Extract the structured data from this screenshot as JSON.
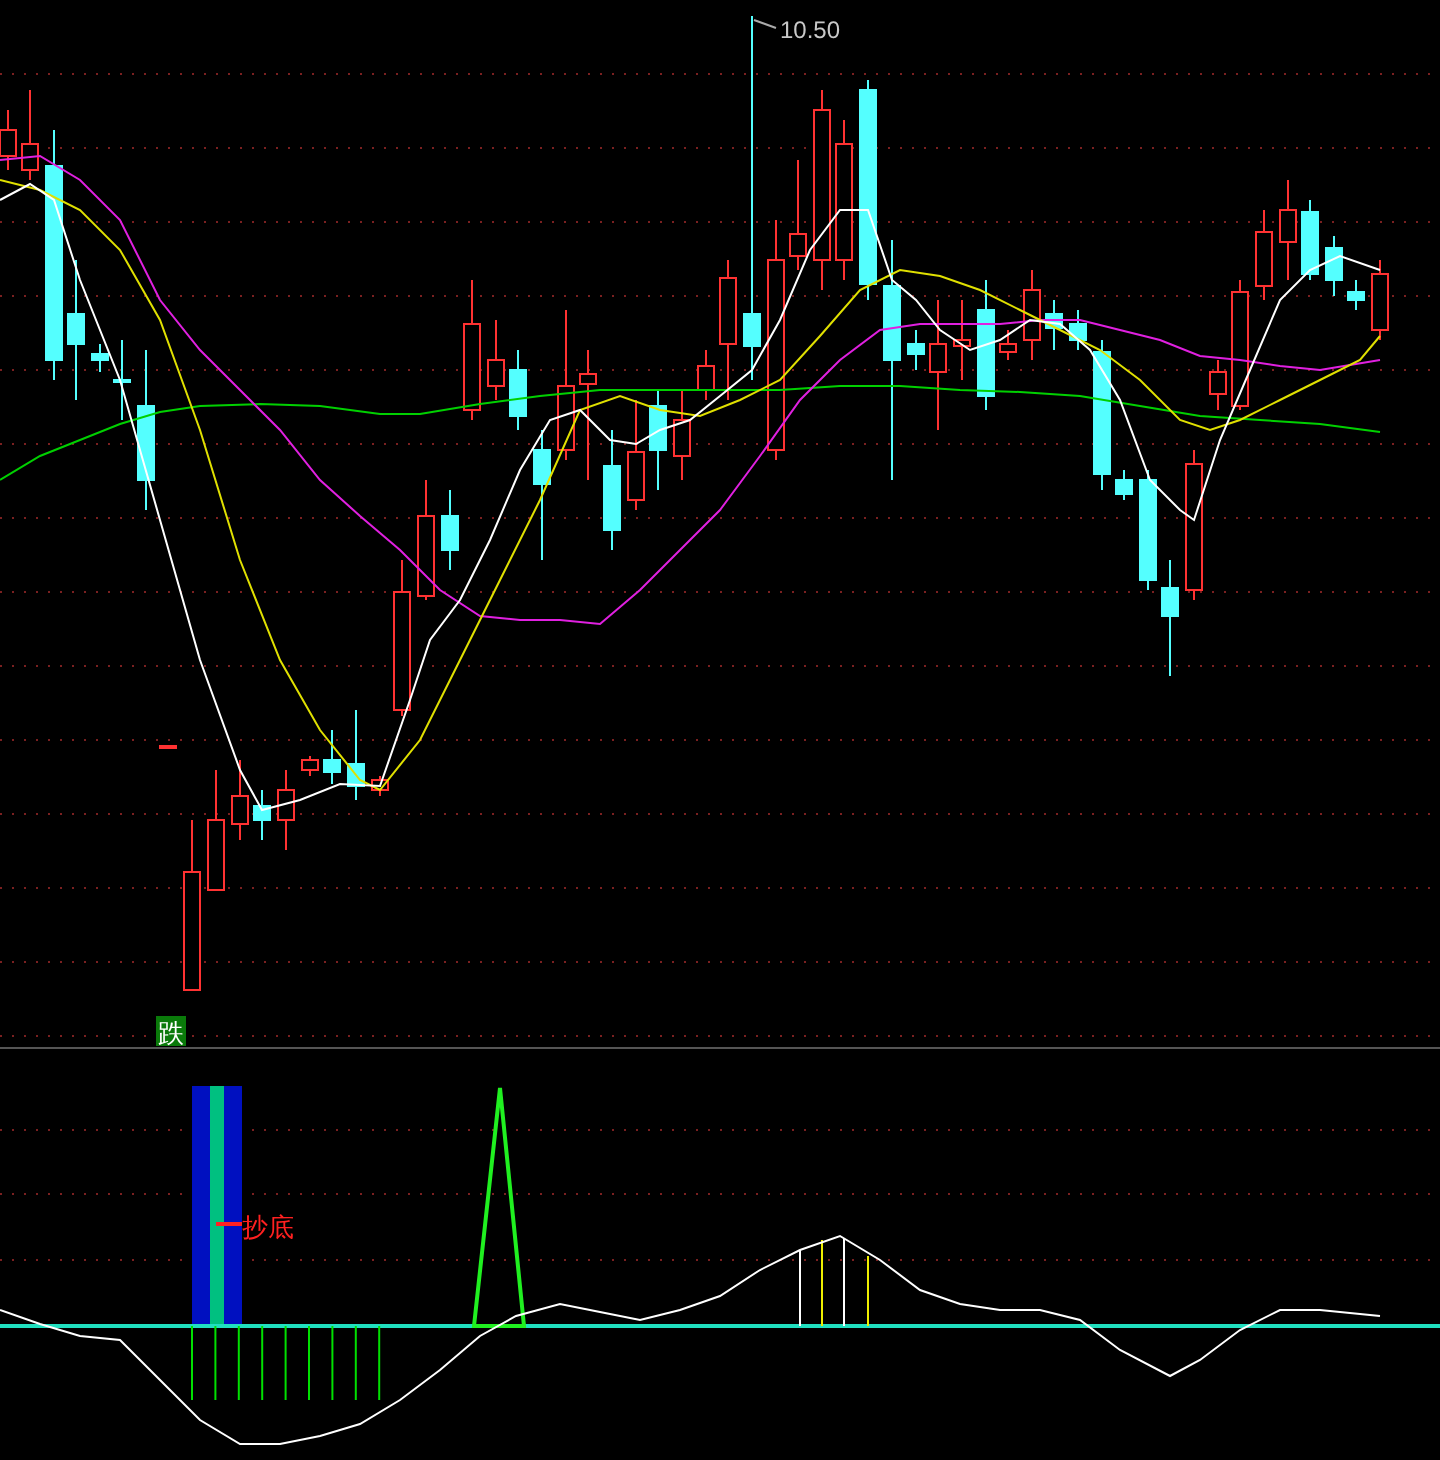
{
  "main_chart": {
    "high_label": "10.50",
    "signal_marker": "跌"
  },
  "indicator": {
    "buy_label": "抄底"
  }
}
